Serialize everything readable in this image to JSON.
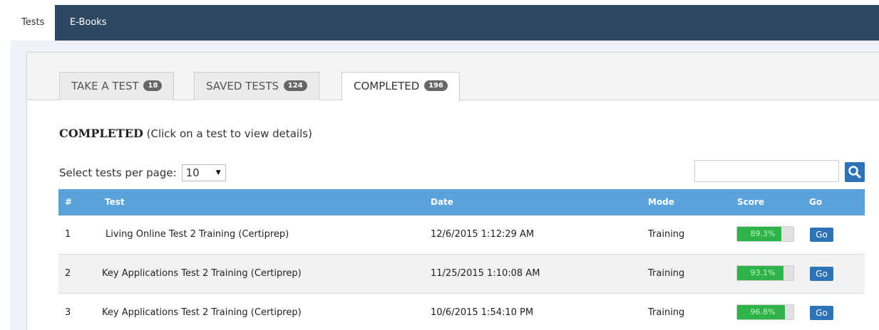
{
  "top_nav": {
    "tabs": [
      {
        "label": "Tests",
        "active": true
      },
      {
        "label": "E-Books",
        "active": false
      }
    ]
  },
  "test_tabs": [
    {
      "label": "TAKE A TEST",
      "count": "18",
      "active": false
    },
    {
      "label": "SAVED TESTS",
      "count": "124",
      "active": false
    },
    {
      "label": "COMPLETED",
      "count": "196",
      "active": true
    }
  ],
  "section": {
    "title": "COMPLETED",
    "hint": "(Click on a test to view details)"
  },
  "pagination": {
    "label": "Select tests per page:",
    "selected": "10"
  },
  "search": {
    "value": "",
    "placeholder": ""
  },
  "table": {
    "columns": [
      "#",
      "Test",
      "Date",
      "Mode",
      "Score",
      "Go"
    ],
    "rows": [
      {
        "num": "1",
        "test": "Living Online Test 2 Training (Certiprep)",
        "date": "12/6/2015 1:12:29 AM",
        "mode": "Training",
        "score": "89.3%",
        "score_value": 89.3,
        "go": "Go"
      },
      {
        "num": "2",
        "test": "Key Applications Test 2 Training (Certiprep)",
        "date": "11/25/2015 1:10:08 AM",
        "mode": "Training",
        "score": "93.1%",
        "score_value": 93.1,
        "go": "Go"
      },
      {
        "num": "3",
        "test": "Key Applications Test 2 Training (Certiprep)",
        "date": "10/6/2015 1:54:10 PM",
        "mode": "Training",
        "score": "96.8%",
        "score_value": 96.8,
        "go": "Go"
      }
    ]
  },
  "colors": {
    "nav_bg": "#2e4862",
    "header_bg": "#5aa2dc",
    "score_fill": "#2db34a",
    "button_bg": "#2e73b8"
  }
}
